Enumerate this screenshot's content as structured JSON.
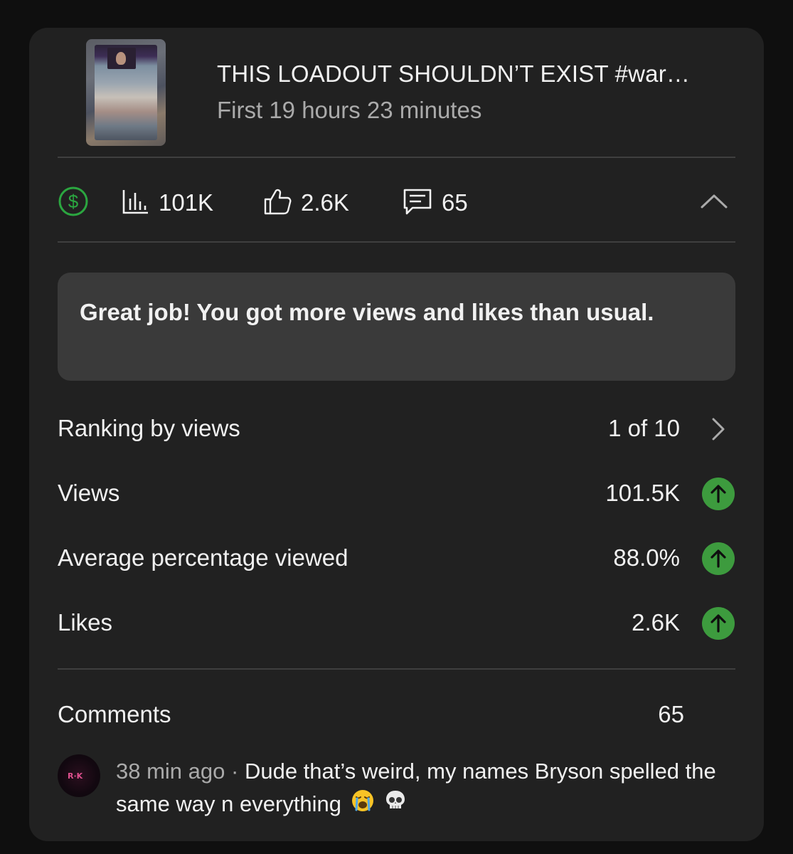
{
  "video": {
    "title": "THIS LOADOUT SHOULDN’T EXIST #war…",
    "period": "First 19 hours 23 minutes"
  },
  "stats": {
    "views": "101K",
    "likes": "2.6K",
    "comments": "65"
  },
  "banner": {
    "text": "Great job! You got more views and likes than usual."
  },
  "metrics": [
    {
      "label": "Ranking by views",
      "value": "1 of 10",
      "indicator": "chevron-right"
    },
    {
      "label": "Views",
      "value": "101.5K",
      "indicator": "up-arrow"
    },
    {
      "label": "Average percentage viewed",
      "value": "88.0%",
      "indicator": "up-arrow"
    },
    {
      "label": "Likes",
      "value": "2.6K",
      "indicator": "up-arrow"
    }
  ],
  "comments_section": {
    "label": "Comments",
    "count": "65",
    "latest": {
      "time": "38 min ago",
      "separator": " · ",
      "text": "Dude that’s weird, my names Bryson spelled the same way n everything"
    }
  },
  "colors": {
    "background": "#0f0f0f",
    "card": "#212121",
    "banner": "#3a3a3a",
    "accent_green": "#3d9b3e",
    "monetization_green": "#2ba640",
    "muted_text": "#aaaaaa"
  }
}
